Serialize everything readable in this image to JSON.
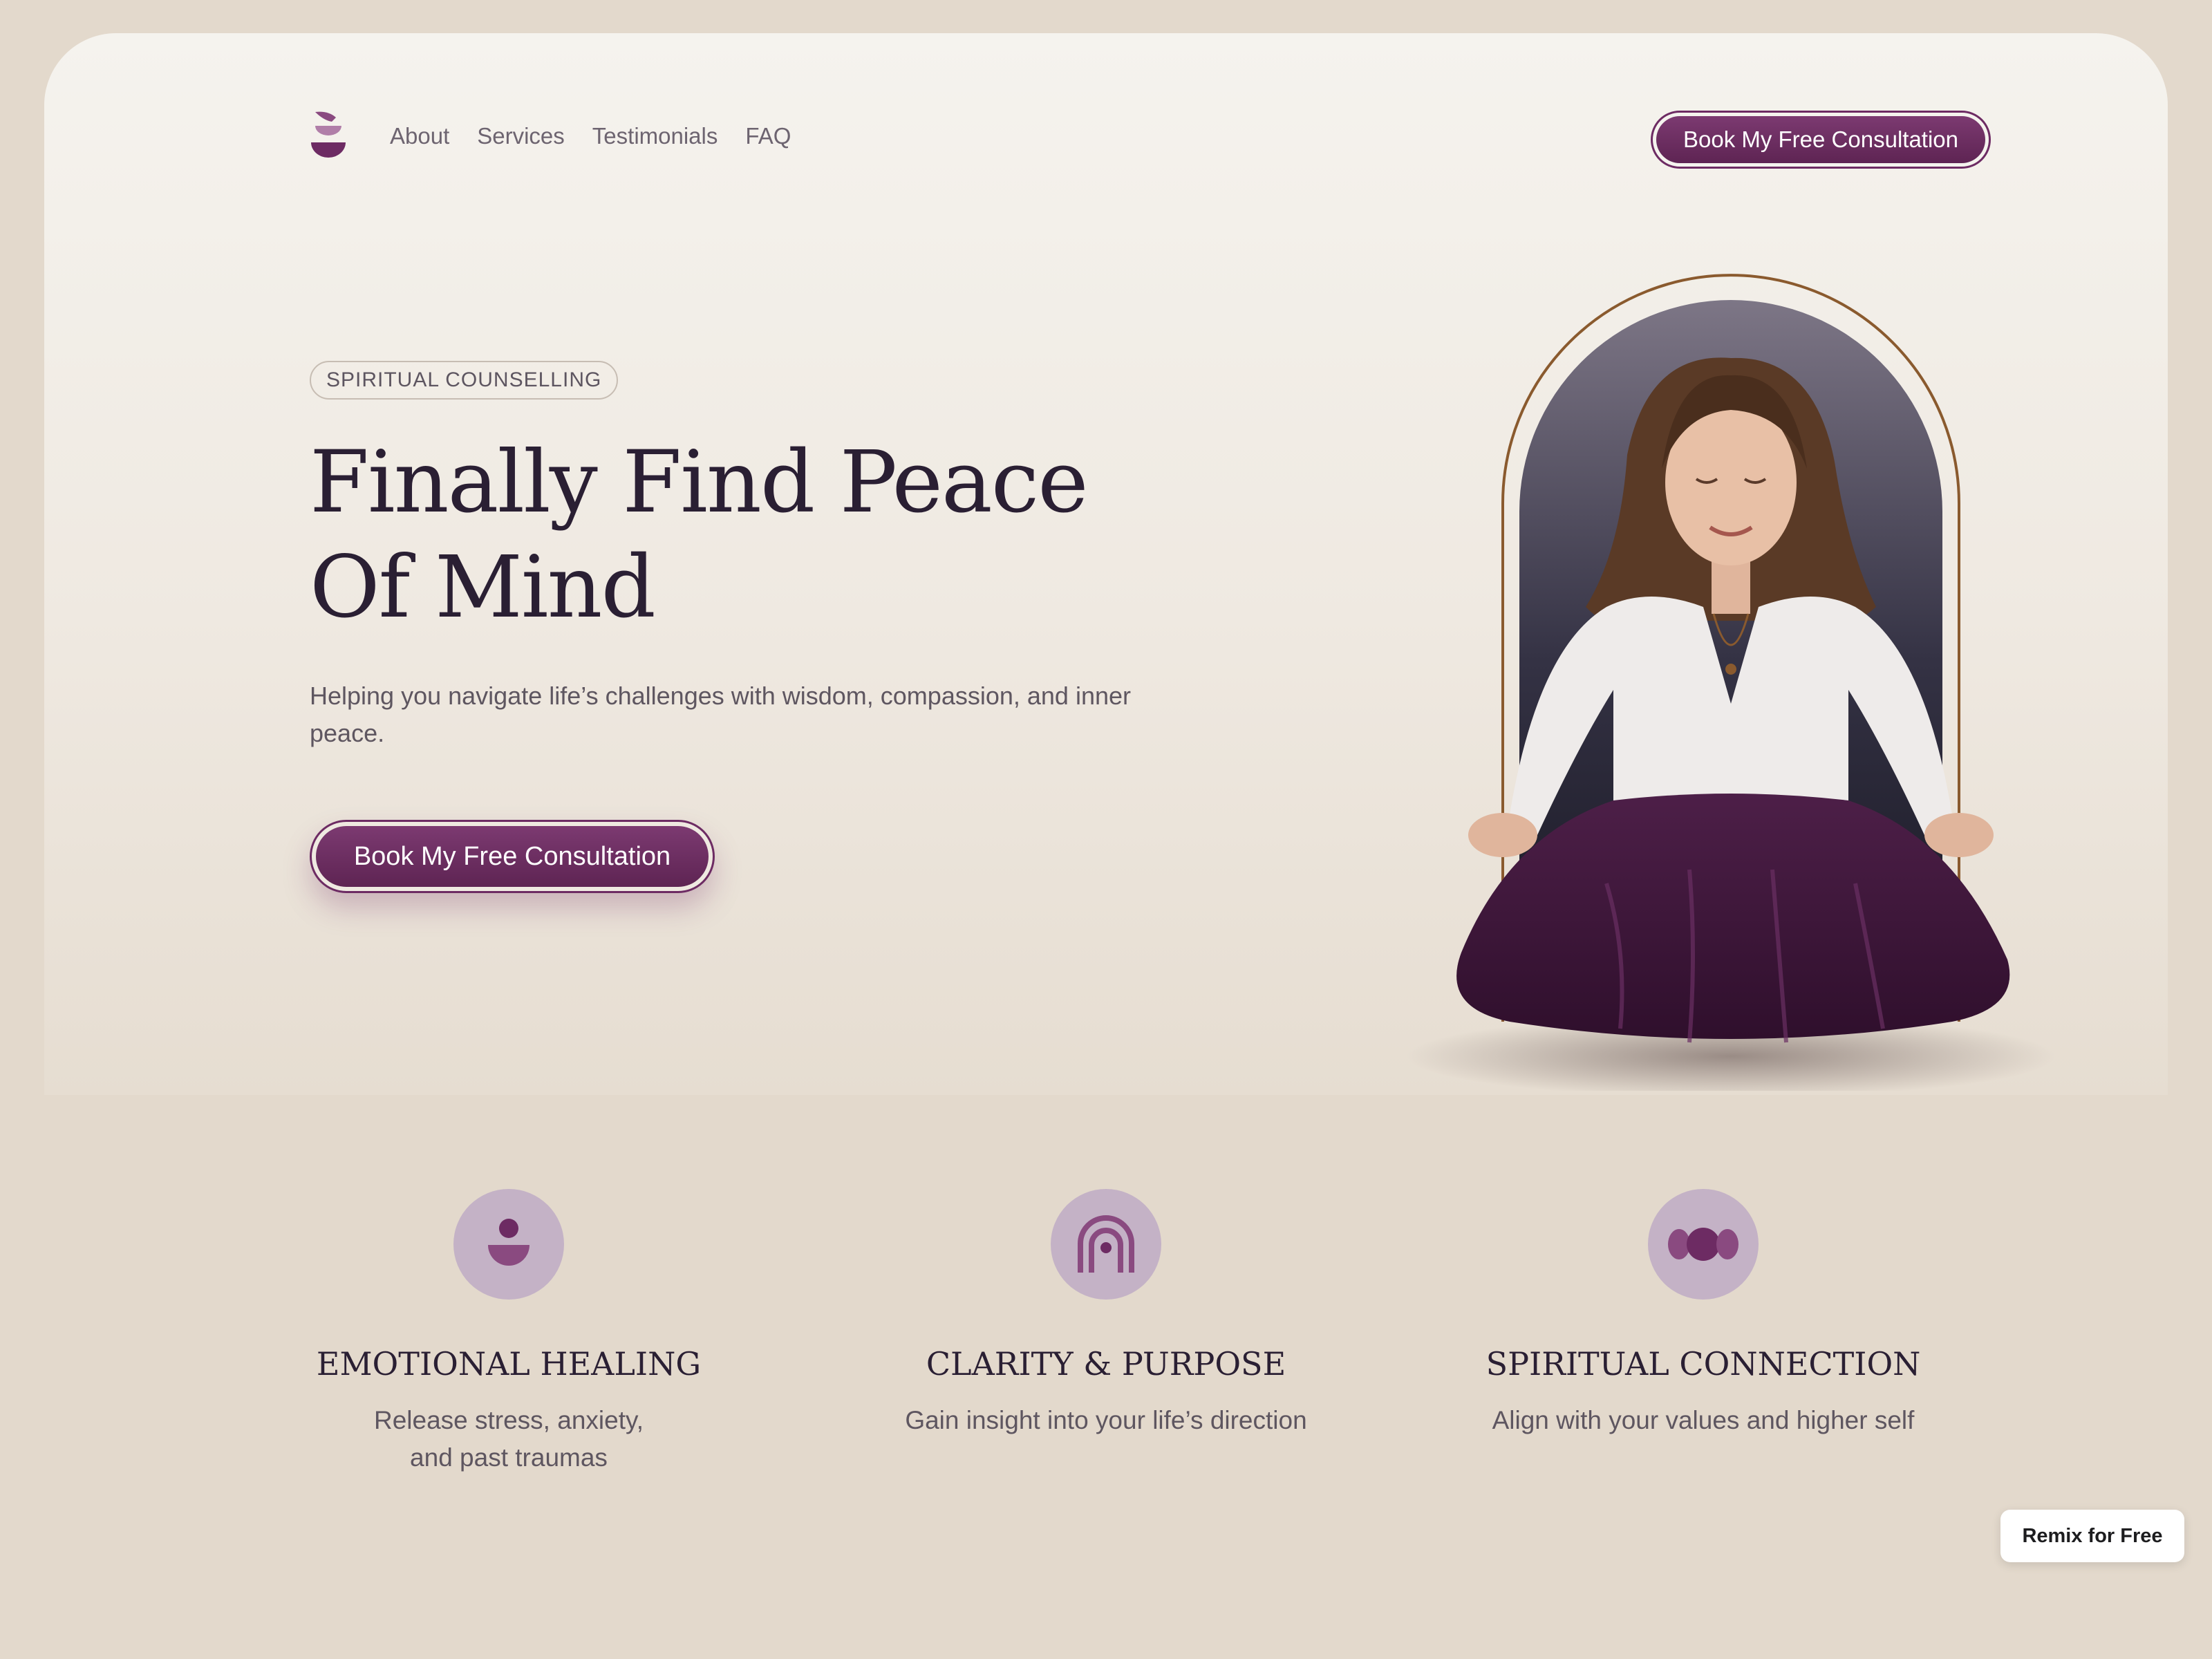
{
  "nav": {
    "links": [
      "About",
      "Services",
      "Testimonials",
      "FAQ"
    ],
    "cta_label": "Book My Free Consultation"
  },
  "hero": {
    "badge": "SPIRITUAL COUNSELLING",
    "title": "Finally Find Peace Of Mind",
    "subtitle": "Helping you navigate life’s challenges with wisdom, compassion, and inner peace.",
    "cta_label": "Book My Free Consultation",
    "image_icon": "meditating-woman-arch-image"
  },
  "features": [
    {
      "icon": "emotional-healing-icon",
      "title": "EMOTIONAL HEALING",
      "line1": "Release stress, anxiety,",
      "line2": "and past traumas"
    },
    {
      "icon": "clarity-arch-icon",
      "title": "CLARITY & PURPOSE",
      "line1": "Gain insight into your life’s direction",
      "line2": ""
    },
    {
      "icon": "spiritual-connection-icon",
      "title": "SPIRITUAL CONNECTION",
      "line1": "Align with your values and higher self",
      "line2": ""
    }
  ],
  "remix_label": "Remix for Free",
  "colors": {
    "brand": "#6d2b63",
    "background": "#e3d9cc",
    "icon_bg": "#c4b2c6"
  }
}
